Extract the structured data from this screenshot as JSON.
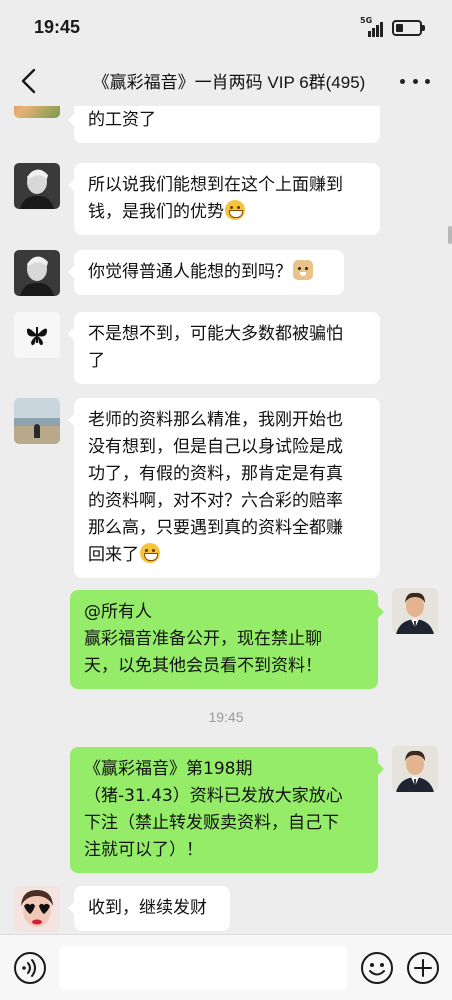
{
  "status_bar": {
    "time": "19:45",
    "network": "5G",
    "signal_bars": 4,
    "battery_level": 0.3
  },
  "nav": {
    "title": "《赢彩福音》一肖两码 VIP 6群(495)",
    "back_icon": "chevron-left-icon",
    "more_icon": "more-dots-icon"
  },
  "messages": [
    {
      "side": "left",
      "avatar": "avatar-food-photo",
      "lines": [
        "的工资了"
      ]
    },
    {
      "side": "left",
      "avatar": "avatar-man-bw",
      "lines": [
        "所以说我们能想到在这个上面赚到",
        "钱，是我们的优势"
      ],
      "emoji_after_last": "grin-emoji"
    },
    {
      "side": "left",
      "avatar": "avatar-man-bw",
      "lines": [
        "你觉得普通人能想的到吗？"
      ],
      "emoji_after_last": "doge-emoji"
    },
    {
      "side": "left",
      "avatar": "avatar-butterfly",
      "lines": [
        "不是想不到，可能大多数都被骗怕",
        "了"
      ]
    },
    {
      "side": "left",
      "avatar": "avatar-beach",
      "lines": [
        "老师的资料那么精准，我刚开始也",
        "没有想到，但是自己以身试险是成",
        "功了，有假的资料，那肯定是有真",
        "的资料啊，对不对？六合彩的赔率",
        "那么高，只要遇到真的资料全都赚",
        "回来了"
      ],
      "emoji_after_last": "grin-emoji"
    },
    {
      "side": "right",
      "avatar": "avatar-man-suit",
      "lines": [
        "@所有人",
        "赢彩福音准备公开，现在禁止聊",
        "天，以免其他会员看不到资料！"
      ]
    },
    {
      "side": "right",
      "avatar": "avatar-man-suit",
      "lines": [
        "《赢彩福音》第198期",
        "（猪-31.43）资料已发放大家放心",
        "下注（禁止转发贩卖资料，自己下",
        "注就可以了）！"
      ]
    },
    {
      "side": "left",
      "avatar": "avatar-woman-heart-glasses",
      "lines": [
        "收到，继续发财"
      ]
    }
  ],
  "timestamp": "19:45",
  "input_bar": {
    "voice_icon": "voice-icon",
    "input_placeholder": "",
    "emoji_icon": "emoji-face-icon",
    "plus_icon": "plus-circle-icon"
  }
}
